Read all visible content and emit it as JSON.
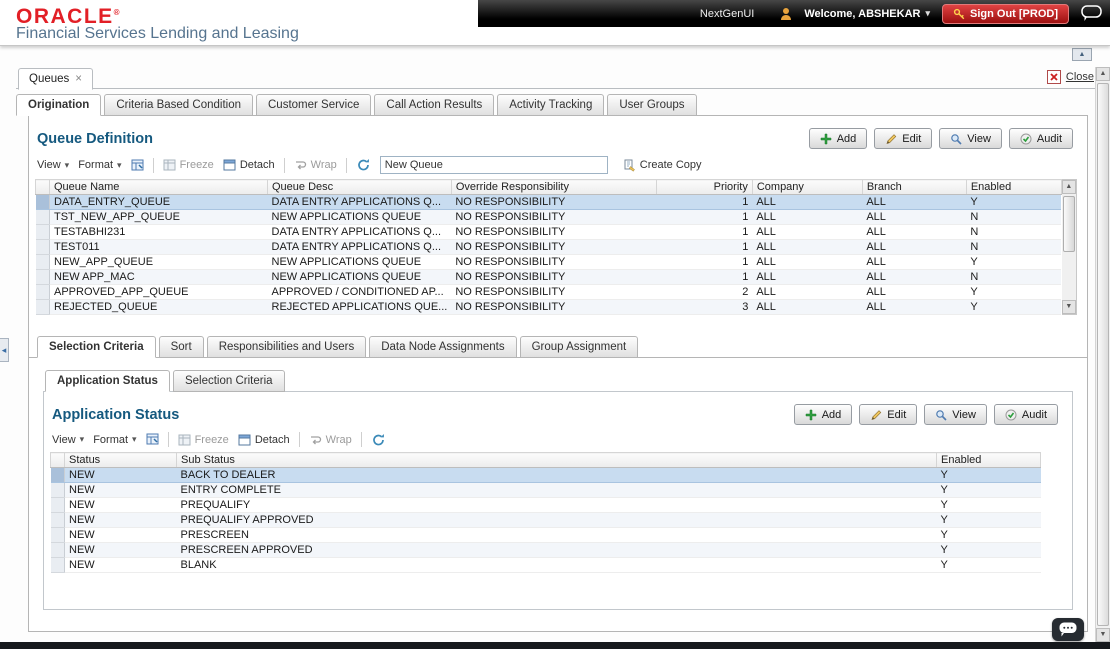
{
  "header": {
    "logo": "ORACLE",
    "logo_reg": "®",
    "subtitle": "Financial Services Lending and Leasing",
    "nextgen_label": "NextGenUI",
    "welcome_label": "Welcome, ABSHEKAR",
    "signout_label": "Sign Out [PROD]"
  },
  "icons": {
    "caret_down": "▾",
    "scroll_up": "▲",
    "scroll_down": "▼",
    "collapse_up": "▲",
    "splitter_left": "◂",
    "tab_close": "×"
  },
  "page": {
    "doc_tab": "Queues",
    "close_label": "Close"
  },
  "main_tabs": [
    "Origination",
    "Criteria Based Condition",
    "Customer Service",
    "Call Action Results",
    "Activity Tracking",
    "User Groups"
  ],
  "queue_definition": {
    "title": "Queue Definition",
    "buttons": [
      "Add",
      "Edit",
      "View",
      "Audit"
    ],
    "toolbar": {
      "view": "View",
      "format": "Format",
      "freeze": "Freeze",
      "detach": "Detach",
      "wrap": "Wrap",
      "search_value": "New Queue",
      "create_copy": "Create Copy"
    },
    "columns": [
      "Queue Name",
      "Queue Desc",
      "Override Responsibility",
      "Priority",
      "Company",
      "Branch",
      "Enabled"
    ],
    "selected_row": 0,
    "rows": [
      [
        "DATA_ENTRY_QUEUE",
        "DATA ENTRY APPLICATIONS Q...",
        "NO RESPONSIBILITY",
        "1",
        "ALL",
        "ALL",
        "Y"
      ],
      [
        "TST_NEW_APP_QUEUE",
        "NEW APPLICATIONS QUEUE",
        "NO RESPONSIBILITY",
        "1",
        "ALL",
        "ALL",
        "N"
      ],
      [
        "TESTABHI231",
        "DATA ENTRY APPLICATIONS Q...",
        "NO RESPONSIBILITY",
        "1",
        "ALL",
        "ALL",
        "N"
      ],
      [
        "TEST011",
        "DATA ENTRY APPLICATIONS Q...",
        "NO RESPONSIBILITY",
        "1",
        "ALL",
        "ALL",
        "N"
      ],
      [
        "NEW_APP_QUEUE",
        "NEW APPLICATIONS QUEUE",
        "NO RESPONSIBILITY",
        "1",
        "ALL",
        "ALL",
        "Y"
      ],
      [
        "NEW APP_MAC",
        "NEW APPLICATIONS QUEUE",
        "NO RESPONSIBILITY",
        "1",
        "ALL",
        "ALL",
        "N"
      ],
      [
        "APPROVED_APP_QUEUE",
        "APPROVED / CONDITIONED AP...",
        "NO RESPONSIBILITY",
        "2",
        "ALL",
        "ALL",
        "Y"
      ],
      [
        "REJECTED_QUEUE",
        "REJECTED APPLICATIONS QUE...",
        "NO RESPONSIBILITY",
        "3",
        "ALL",
        "ALL",
        "Y"
      ]
    ]
  },
  "detail_tabs": [
    "Selection Criteria",
    "Sort",
    "Responsibilities and Users",
    "Data Node Assignments",
    "Group Assignment"
  ],
  "inner_tabs": [
    "Application Status",
    "Selection Criteria"
  ],
  "application_status": {
    "title": "Application Status",
    "buttons": [
      "Add",
      "Edit",
      "View",
      "Audit"
    ],
    "toolbar": {
      "view": "View",
      "format": "Format",
      "freeze": "Freeze",
      "detach": "Detach",
      "wrap": "Wrap"
    },
    "columns": [
      "Status",
      "Sub Status",
      "Enabled"
    ],
    "selected_row": 0,
    "rows": [
      [
        "NEW",
        "BACK TO DEALER",
        "Y"
      ],
      [
        "NEW",
        "ENTRY COMPLETE",
        "Y"
      ],
      [
        "NEW",
        "PREQUALIFY",
        "Y"
      ],
      [
        "NEW",
        "PREQUALIFY APPROVED",
        "Y"
      ],
      [
        "NEW",
        "PRESCREEN",
        "Y"
      ],
      [
        "NEW",
        "PRESCREEN APPROVED",
        "Y"
      ],
      [
        "NEW",
        "BLANK",
        "Y"
      ]
    ]
  }
}
